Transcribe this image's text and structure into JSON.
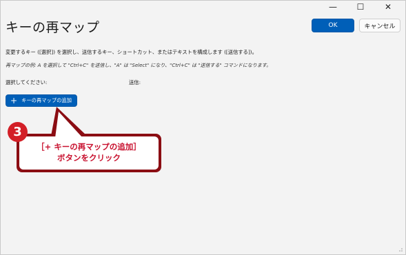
{
  "window": {
    "title": "キーの再マップ",
    "controls": {
      "minimize": "—",
      "maximize": "☐",
      "close": "✕"
    }
  },
  "buttons": {
    "ok": "OK",
    "cancel": "キャンセル"
  },
  "content": {
    "description": "変更するキー ([選択]) を選択し、送信するキー、ショートカット、またはテキストを構成します ([送信する])。",
    "example": "再マップの例: A を選択して \"Ctrl+C\" を送信し、\"A\" は \"Select\" になり、\"Ctrl+C\" は \"送信する\" コマンドになります。",
    "column_select": "選択してください:",
    "column_send": "送信:",
    "add_button": "キーの再マップの追加",
    "add_button_icon": "plus-icon"
  },
  "annotation": {
    "badge": "3",
    "line1": "［+ キーの再マップの追加］",
    "line2": "ボタンをクリック"
  },
  "colors": {
    "accent": "#005fb8",
    "callout": "#c8102e",
    "callout_dark": "#8b0d13"
  }
}
